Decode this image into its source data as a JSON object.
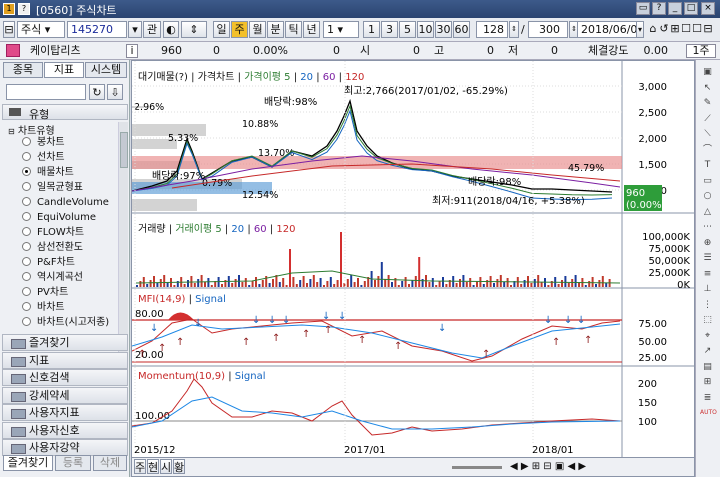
{
  "window": {
    "title": "[0560] 주식차트",
    "badge_num": "1",
    "badge_q": "?",
    "buttons": [
      "▭",
      "?",
      "_",
      "□",
      "×"
    ]
  },
  "toolbar": {
    "market": "주식",
    "code": "145270",
    "search_label": "관",
    "periods": [
      "일",
      "주",
      "월",
      "분",
      "틱",
      "년"
    ],
    "active_period": "주",
    "interval_value": "1",
    "interval_buttons": [
      "1",
      "3",
      "5",
      "10",
      "30",
      "60"
    ],
    "count_value": "128",
    "slash": "/",
    "total": "300",
    "date": "2018/06/01",
    "right_icons": [
      "⌂",
      "↺",
      "⊞",
      "☐",
      "☐",
      "⊟",
      "⊞"
    ]
  },
  "infobar": {
    "name": "케이탑리츠",
    "i_label": "i",
    "price": "960",
    "change": "0",
    "change_pct": "0.00%",
    "vol": "0",
    "open_label": "시",
    "open": "0",
    "high_label": "고",
    "high": "0",
    "low_label": "저",
    "low": "0",
    "strength_label": "체결강도",
    "strength": "0.00",
    "unit_btn": "1주"
  },
  "leftpanel": {
    "tabs": [
      "종목",
      "지표",
      "시스템"
    ],
    "active_tab": "지표",
    "section_title": "유형",
    "group_title": "차트유형",
    "items": [
      "봉차트",
      "선차트",
      "매물차트",
      "일목균형표",
      "CandleVolume",
      "EquiVolume",
      "FLOW차트",
      "삼선전환도",
      "P&F차트",
      "역시계곡선",
      "PV차트",
      "바차트",
      "바차트(시고저종)"
    ],
    "selected_item": "매물차트",
    "folders": [
      "즐겨찾기",
      "지표",
      "신호검색",
      "강세약세",
      "사용자지표",
      "사용자신호",
      "사용자강약"
    ],
    "bottom_tabs": [
      "즐겨찾기",
      "등록",
      "삭제"
    ]
  },
  "chart": {
    "pane1_legend": [
      "대기매물(?)",
      "가격차트",
      "가격이평 5",
      "20",
      "60",
      "120"
    ],
    "pane2_legend": [
      "거래량",
      "거래이평 5",
      "20",
      "60",
      "120"
    ],
    "pane3_legend": [
      "MFI(14,9)",
      "Signal"
    ],
    "pane4_legend": [
      "Momentum(10,9)",
      "Signal"
    ],
    "price_axis": [
      "3,000",
      "2,500",
      "2,000",
      "1,500",
      "1,000"
    ],
    "volume_axis": [
      "100,000K",
      "75,000K",
      "50,000K",
      "25,000K",
      "0K"
    ],
    "mfi_axis": [
      "75.00",
      "50.00",
      "25.00"
    ],
    "momentum_axis": [
      "200",
      "150",
      "100"
    ],
    "price_tag": "960",
    "price_tag_pct": "(0.00%)",
    "annotations": {
      "high": "최고:2,766(2017/01/02, -65.29%)",
      "low": "최저:911(2018/04/16, +5.38%)",
      "div1": "배당락:98%",
      "div2": "배당락:97%",
      "div3": "배당락:98%"
    },
    "overhang_pcts": [
      "2.96%",
      "10.88%",
      "5.33%",
      "13.70%",
      "0.79%",
      "12.54%",
      "45.79%"
    ],
    "mfi_levels": [
      "80.00",
      "20.00"
    ],
    "momentum_level": "100.00",
    "x_labels": [
      "2015/12",
      "2017/01",
      "2018/01"
    ],
    "bottom_controls": [
      "주",
      "현",
      "시",
      "황"
    ]
  },
  "colors": {
    "accent": "#f3c02a",
    "price_line": "#000000",
    "ma5": "#2e7d32",
    "ma20": "#1565c0",
    "ma60": "#7b1fa2",
    "ma120": "#c62828",
    "overhang_red": "#e88a8a",
    "overhang_blue": "#5b9bd5"
  }
}
